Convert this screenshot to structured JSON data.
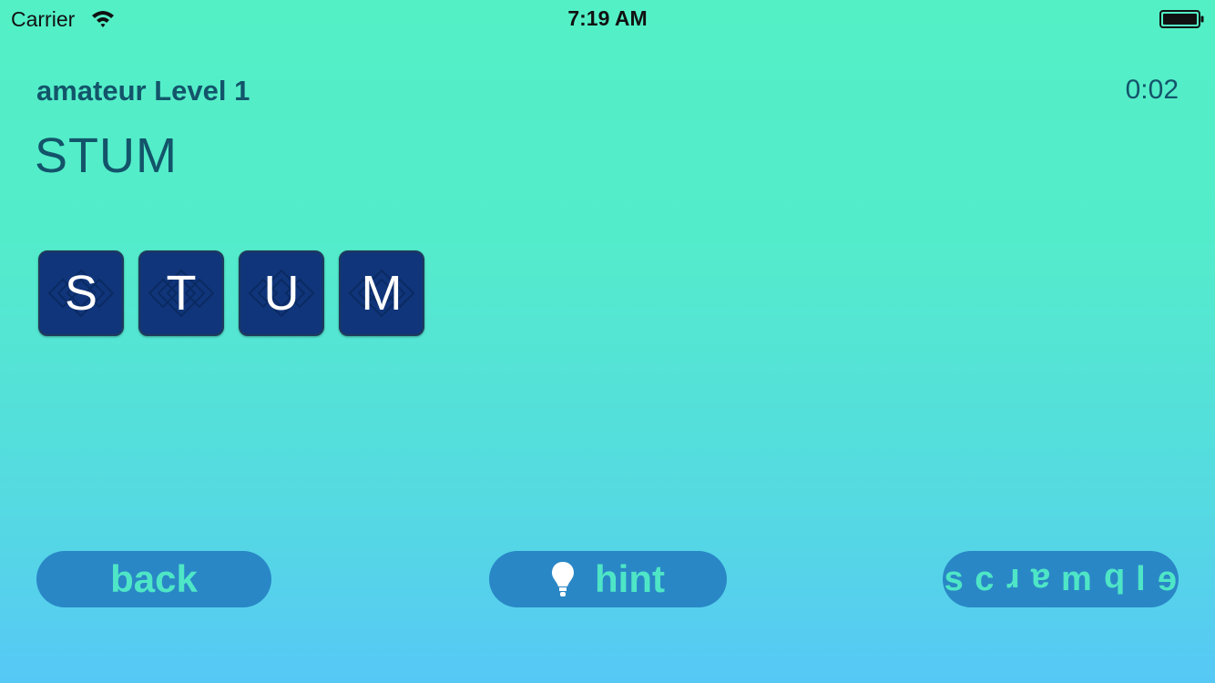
{
  "status_bar": {
    "carrier": "Carrier",
    "time": "7:19 AM",
    "icons": [
      "wifi-icon",
      "battery-icon"
    ]
  },
  "game": {
    "level_title": "amateur Level 1",
    "timer": "0:02",
    "current_word": "STUM",
    "tiles": [
      "S",
      "T",
      "U",
      "M"
    ]
  },
  "buttons": {
    "back_label": "back",
    "hint_label": "hint",
    "hint_icon": "lightbulb-icon",
    "scramble_label": "scramble",
    "scramble_letters": [
      "s",
      "c",
      "r",
      "a",
      "m",
      "b",
      "l",
      "e"
    ]
  },
  "colors": {
    "background_top": "#53F0C6",
    "background_bottom": "#56C8F6",
    "tile": "#10357A",
    "button": "#2A87C6",
    "button_text": "#4EE6C6",
    "title_text": "#13546A"
  }
}
